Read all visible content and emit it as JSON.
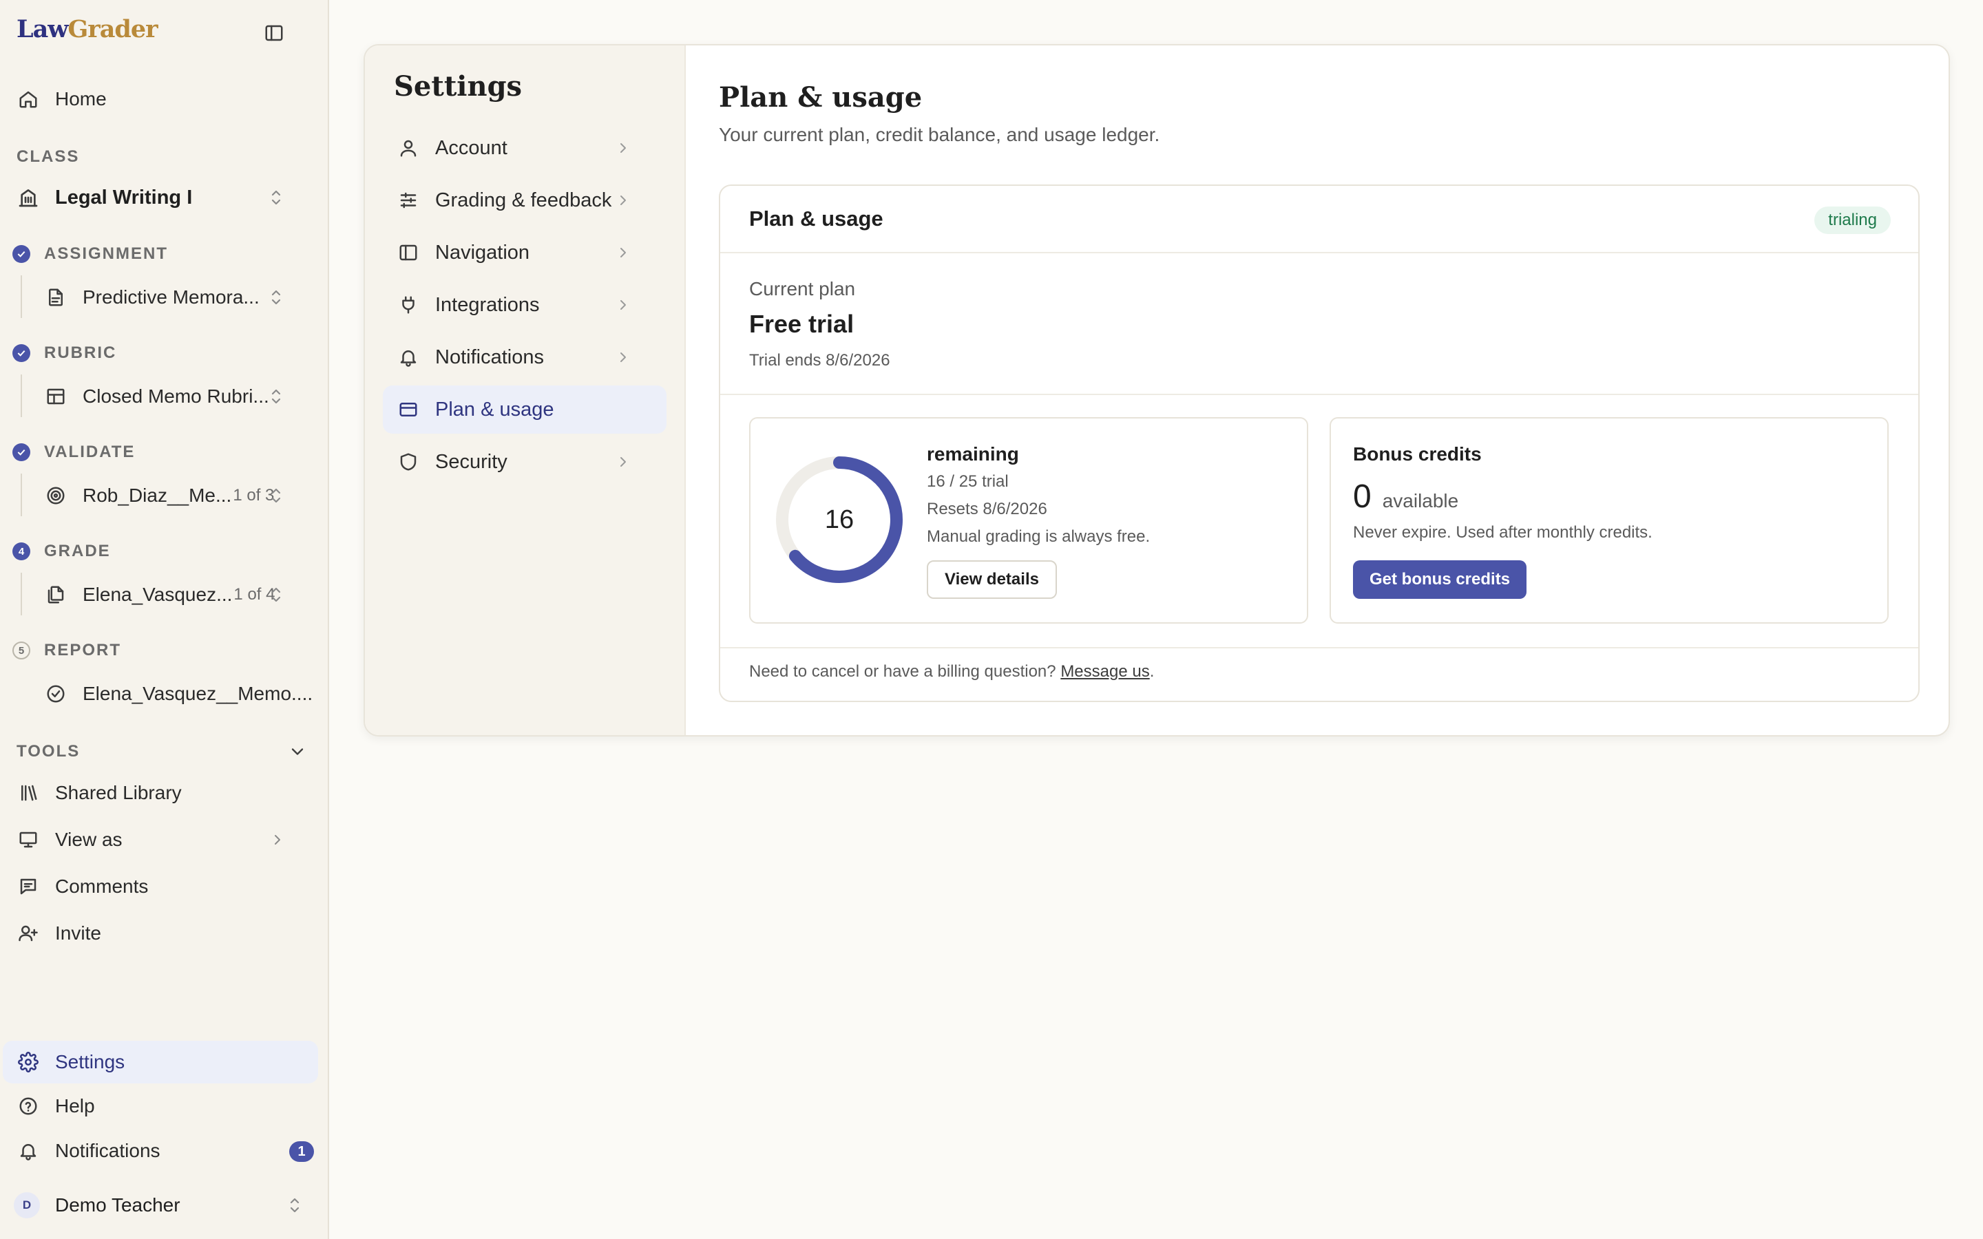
{
  "brand": {
    "part1": "Law",
    "part2": "Grader"
  },
  "sidebar": {
    "home_label": "Home",
    "class_section": "CLASS",
    "class_name": "Legal Writing I",
    "steps": [
      {
        "badge": "",
        "label": "ASSIGNMENT",
        "item": "Predictive Memora...",
        "count": ""
      },
      {
        "badge": "",
        "label": "RUBRIC",
        "item": "Closed Memo Rubri...",
        "count": ""
      },
      {
        "badge": "",
        "label": "VALIDATE",
        "item": "Rob_Diaz__Me...",
        "count": "1 of 3"
      },
      {
        "badge": "4",
        "label": "GRADE",
        "item": "Elena_Vasquez...",
        "count": "1 of 4"
      },
      {
        "badge": "5",
        "label": "REPORT",
        "item": "Elena_Vasquez__Memo....",
        "count": ""
      }
    ],
    "tools_section": "TOOLS",
    "tools": [
      "Shared Library",
      "View as",
      "Comments",
      "Invite"
    ],
    "settings_label": "Settings",
    "help_label": "Help",
    "notifications_label": "Notifications",
    "notifications_count": "1",
    "user": {
      "initial": "D",
      "name": "Demo Teacher"
    }
  },
  "settings_nav": {
    "title": "Settings",
    "items": [
      "Account",
      "Grading & feedback",
      "Navigation",
      "Integrations",
      "Notifications",
      "Plan & usage",
      "Security"
    ],
    "active": "Plan & usage"
  },
  "content": {
    "title": "Plan & usage",
    "subtitle": "Your current plan, credit balance, and usage ledger.",
    "card": {
      "title": "Plan & usage",
      "status": "trialing",
      "current_plan_label": "Current plan",
      "plan_name": "Free trial",
      "trial_ends": "Trial ends 8/6/2026",
      "credits": {
        "remaining": 16,
        "total": 25,
        "label": "remaining",
        "usage_line": "16 / 25 trial",
        "resets": "Resets 8/6/2026",
        "note": "Manual grading is always free.",
        "button": "View details"
      },
      "bonus": {
        "title": "Bonus credits",
        "amount": "0",
        "available_label": "available",
        "note": "Never expire. Used after monthly credits.",
        "button": "Get bonus credits"
      },
      "billing_text": "Need to cancel or have a billing question?",
      "billing_link": "Message us",
      "billing_end": "."
    }
  },
  "colors": {
    "accent": "#4a54a8",
    "ring_track": "#efede8",
    "status_green": "#1e7a4b"
  }
}
